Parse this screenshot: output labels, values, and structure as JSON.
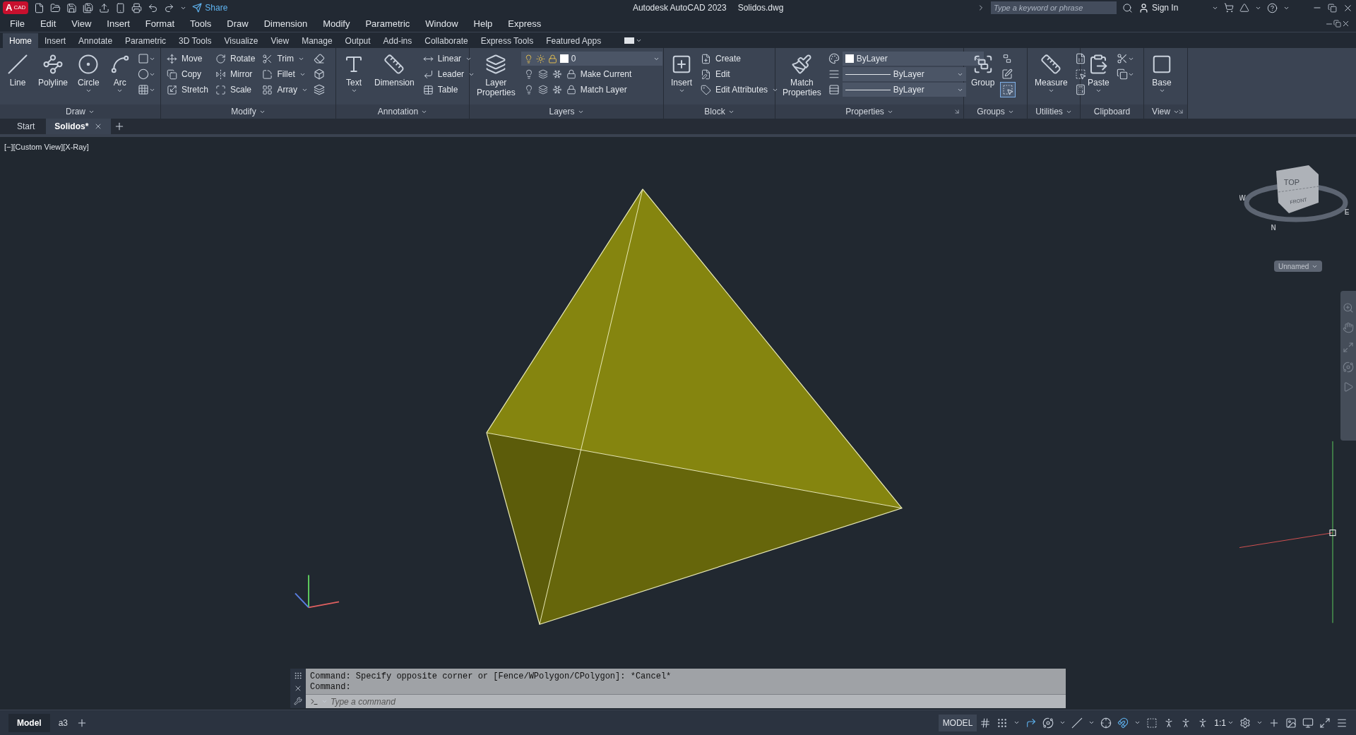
{
  "title_bar": {
    "logo": {
      "letter": "A",
      "text": "CAD"
    },
    "share": "Share",
    "app_title": "Autodesk AutoCAD 2023",
    "file_name": "Solidos.dwg",
    "search": {
      "placeholder": "Type a keyword or phrase"
    },
    "sign_in": "Sign In"
  },
  "menu_bar": [
    "File",
    "Edit",
    "View",
    "Insert",
    "Format",
    "Tools",
    "Draw",
    "Dimension",
    "Modify",
    "Parametric",
    "Window",
    "Help",
    "Express"
  ],
  "ribbon_tabs": [
    {
      "label": "Home",
      "selected": true
    },
    {
      "label": "Insert",
      "selected": false
    },
    {
      "label": "Annotate",
      "selected": false
    },
    {
      "label": "Parametric",
      "selected": false
    },
    {
      "label": "3D Tools",
      "selected": false
    },
    {
      "label": "Visualize",
      "selected": false
    },
    {
      "label": "View",
      "selected": false
    },
    {
      "label": "Manage",
      "selected": false
    },
    {
      "label": "Output",
      "selected": false
    },
    {
      "label": "Add-ins",
      "selected": false
    },
    {
      "label": "Collaborate",
      "selected": false
    },
    {
      "label": "Express Tools",
      "selected": false
    },
    {
      "label": "Featured Apps",
      "selected": false
    }
  ],
  "ribbon_panels": [
    {
      "title": "Draw",
      "menu": true,
      "launcher": false,
      "columns": [
        {
          "kind": "large",
          "label": "Line",
          "dropdown": false
        },
        {
          "kind": "large",
          "label": "Polyline",
          "dropdown": false
        },
        {
          "kind": "large",
          "label": "Circle",
          "dropdown": true
        },
        {
          "kind": "large",
          "label": "Arc",
          "dropdown": true
        },
        {
          "kind": "stack",
          "items": [
            {
              "kind": "icon",
              "dropdown": true
            },
            {
              "kind": "icon",
              "dropdown": true
            },
            {
              "kind": "icon",
              "dropdown": true
            }
          ]
        }
      ]
    },
    {
      "title": "Modify",
      "menu": true,
      "launcher": false,
      "columns": [
        {
          "kind": "stack",
          "items": [
            {
              "kind": "tool",
              "label": "Move",
              "dropdown": false
            },
            {
              "kind": "tool",
              "label": "Copy",
              "dropdown": false
            },
            {
              "kind": "tool",
              "label": "Stretch",
              "dropdown": false
            }
          ]
        },
        {
          "kind": "stack",
          "items": [
            {
              "kind": "tool",
              "label": "Rotate",
              "dropdown": false
            },
            {
              "kind": "tool",
              "label": "Mirror",
              "dropdown": false
            },
            {
              "kind": "tool",
              "label": "Scale",
              "dropdown": false
            }
          ]
        },
        {
          "kind": "stack",
          "items": [
            {
              "kind": "tool",
              "label": "Trim",
              "dropdown": true
            },
            {
              "kind": "tool",
              "label": "Fillet",
              "dropdown": true
            },
            {
              "kind": "tool",
              "label": "Array",
              "dropdown": true
            }
          ]
        },
        {
          "kind": "stack",
          "items": [
            {
              "kind": "icon",
              "dropdown": false
            },
            {
              "kind": "icon",
              "dropdown": false
            },
            {
              "kind": "icon",
              "dropdown": false
            }
          ]
        }
      ]
    },
    {
      "title": "Annotation",
      "menu": true,
      "launcher": false,
      "columns": [
        {
          "kind": "large",
          "label": "Text",
          "dropdown": true
        },
        {
          "kind": "large",
          "label": "Dimension",
          "dropdown": false
        },
        {
          "kind": "stack",
          "items": [
            {
              "kind": "tool",
              "label": "Linear",
              "dropdown": true
            },
            {
              "kind": "tool",
              "label": "Leader",
              "dropdown": true
            },
            {
              "kind": "tool",
              "label": "Table",
              "dropdown": false
            }
          ]
        }
      ]
    },
    {
      "title": "Layers",
      "menu": true,
      "launcher": false,
      "columns": [
        {
          "kind": "large",
          "label": "Layer Properties",
          "dropdown": false
        },
        {
          "kind": "stack",
          "items": [
            {
              "kind": "combo",
              "value": "0",
              "color": "#ffffff",
              "icons": true
            },
            {
              "kind": "layer_row",
              "label": "Make Current"
            },
            {
              "kind": "layer_row",
              "label": "Match Layer"
            }
          ]
        }
      ]
    },
    {
      "title": "Block",
      "menu": true,
      "launcher": false,
      "columns": [
        {
          "kind": "large",
          "label": "Insert",
          "dropdown": true
        },
        {
          "kind": "stack",
          "items": [
            {
              "kind": "tool",
              "label": "Create",
              "dropdown": false
            },
            {
              "kind": "tool",
              "label": "Edit",
              "dropdown": false
            },
            {
              "kind": "tool",
              "label": "Edit Attributes",
              "dropdown": true
            }
          ]
        }
      ]
    },
    {
      "title": "Properties",
      "menu": true,
      "launcher": true,
      "columns": [
        {
          "kind": "large",
          "label": "Match Properties",
          "dropdown": false
        },
        {
          "kind": "stack",
          "items": [
            {
              "kind": "icon",
              "dropdown": false
            },
            {
              "kind": "icon",
              "dropdown": false
            },
            {
              "kind": "icon",
              "dropdown": false
            }
          ]
        },
        {
          "kind": "stack",
          "items": [
            {
              "kind": "combo",
              "value": "ByLayer",
              "color": "#ffffff",
              "icons": false
            },
            {
              "kind": "linecombo",
              "value": "ByLayer"
            },
            {
              "kind": "linecombo",
              "value": "ByLayer"
            }
          ]
        }
      ]
    },
    {
      "title": "Groups",
      "menu": true,
      "launcher": false,
      "columns": [
        {
          "kind": "large",
          "label": "Group",
          "dropdown": false
        },
        {
          "kind": "stack",
          "items": [
            {
              "kind": "icon",
              "dropdown": false,
              "on": false
            },
            {
              "kind": "icon",
              "dropdown": false,
              "on": false
            },
            {
              "kind": "icon",
              "dropdown": false,
              "on": true
            }
          ]
        }
      ]
    },
    {
      "title": "Utilities",
      "menu": true,
      "launcher": false,
      "columns": [
        {
          "kind": "large",
          "label": "Measure",
          "dropdown": true
        },
        {
          "kind": "stack",
          "items": [
            {
              "kind": "icon",
              "dropdown": false
            },
            {
              "kind": "icon",
              "dropdown": false
            },
            {
              "kind": "icon",
              "dropdown": false
            }
          ]
        }
      ]
    },
    {
      "title": "Clipboard",
      "menu": false,
      "launcher": false,
      "columns": [
        {
          "kind": "large",
          "label": "Paste",
          "dropdown": true
        },
        {
          "kind": "stack",
          "items": [
            {
              "kind": "icon",
              "dropdown": true
            },
            {
              "kind": "icon",
              "dropdown": true
            }
          ]
        }
      ]
    },
    {
      "title": "View",
      "menu": true,
      "launcher": true,
      "columns": [
        {
          "kind": "large",
          "label": "Base",
          "dropdown": true
        }
      ]
    }
  ],
  "doc_tabs": [
    {
      "label": "Start",
      "selected": false,
      "closable": false
    },
    {
      "label": "Solidos*",
      "selected": true,
      "closable": true
    }
  ],
  "viewport": {
    "label": "[−][Custom View][X-Ray]",
    "viewcube": {
      "top": "TOP",
      "front": "FRONT",
      "compass": [
        "W",
        "N",
        "E"
      ]
    },
    "named_view": "Unnamed"
  },
  "command_line": {
    "history": [
      "Command: Specify opposite corner or [Fence/WPolygon/CPolygon]: *Cancel*",
      "Command:"
    ],
    "placeholder": "Type a command"
  },
  "layout_tabs": [
    {
      "label": "Model",
      "selected": true
    },
    {
      "label": "a3",
      "selected": false
    }
  ],
  "status_bar": {
    "space": "MODEL",
    "scale": "1:1"
  }
}
